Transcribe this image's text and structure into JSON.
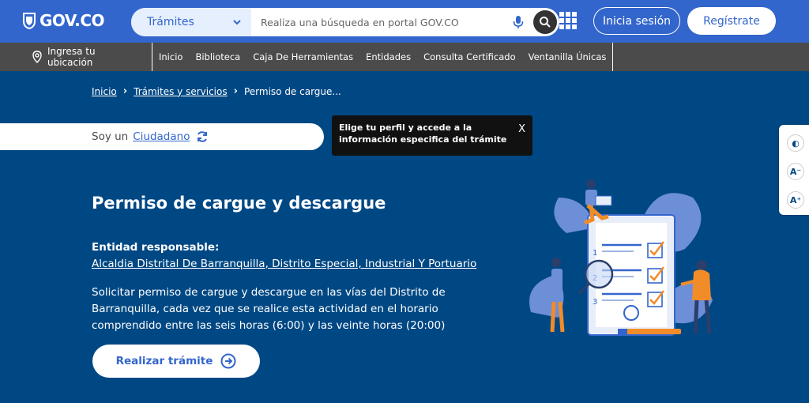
{
  "header": {
    "logo_text": "GOV.CO",
    "search": {
      "category": "Trámites",
      "placeholder": "Realiza una búsqueda en portal GOV.CO"
    },
    "login_label": "Inicia sesión",
    "register_label": "Regístrate"
  },
  "nav": {
    "location_line1": "Ingresa tu",
    "location_line2": "ubicación",
    "items": [
      "Inicio",
      "Biblioteca",
      "Caja De Herramientas",
      "Entidades",
      "Consulta Certificado",
      "Ventanilla Únicas"
    ]
  },
  "breadcrumb": {
    "items": [
      "Inicio",
      "Trámites y servicios"
    ],
    "current": "Permiso de cargue..."
  },
  "profile": {
    "prefix": "Soy un",
    "role": "Ciudadano"
  },
  "tooltip": {
    "text": "Elige tu perfil y accede a la información especifica del trámite",
    "close": "X"
  },
  "tools": {
    "contrast": "◐",
    "decrease_font": "A⁻",
    "increase_font": "A⁺"
  },
  "content": {
    "title": "Permiso de cargue y descargue",
    "entity_label": "Entidad responsable:",
    "entity_name": "Alcaldia Distrital De Barranquilla, Distrito Especial, Industrial Y Portuario",
    "description": "Solicitar permiso de cargue y descargue en las vías del Distrito de Barranquilla, cada vez que se realice esta actividad en el horario comprendido entre las seis horas (6:00) y las veinte horas (20:00)",
    "cta_label": "Realizar trámite"
  },
  "illustration": {
    "list_numbers": [
      "1",
      "2",
      "3"
    ]
  },
  "colors": {
    "primary": "#3366cc",
    "background": "#004884",
    "navbar": "#4b4b4b",
    "accent_orange": "#f28c28"
  }
}
